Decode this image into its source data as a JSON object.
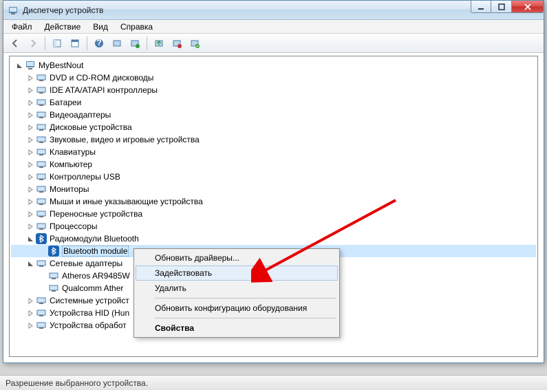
{
  "window": {
    "title": "Диспетчер устройств"
  },
  "menubar": {
    "items": [
      "Файл",
      "Действие",
      "Вид",
      "Справка"
    ]
  },
  "tree": {
    "root": "MyBestNout",
    "categories": [
      {
        "label": "DVD и CD-ROM дисководы",
        "expanded": false
      },
      {
        "label": "IDE ATA/ATAPI контроллеры",
        "expanded": false
      },
      {
        "label": "Батареи",
        "expanded": false
      },
      {
        "label": "Видеоадаптеры",
        "expanded": false
      },
      {
        "label": "Дисковые устройства",
        "expanded": false
      },
      {
        "label": "Звуковые, видео и игровые устройства",
        "expanded": false
      },
      {
        "label": "Клавиатуры",
        "expanded": false
      },
      {
        "label": "Компьютер",
        "expanded": false
      },
      {
        "label": "Контроллеры USB",
        "expanded": false
      },
      {
        "label": "Мониторы",
        "expanded": false
      },
      {
        "label": "Мыши и иные указывающие устройства",
        "expanded": false
      },
      {
        "label": "Переносные устройства",
        "expanded": false
      },
      {
        "label": "Процессоры",
        "expanded": false
      },
      {
        "label": "Радиомодули Bluetooth",
        "expanded": true,
        "children": [
          {
            "label": "Bluetooth module",
            "selected": true
          }
        ]
      },
      {
        "label": "Сетевые адаптеры",
        "expanded": true,
        "children": [
          {
            "label": "Atheros AR9485W"
          },
          {
            "label": "Qualcomm Ather"
          }
        ]
      },
      {
        "label": "Системные устройст",
        "expanded": false
      },
      {
        "label": "Устройства HID (Hun",
        "expanded": false
      },
      {
        "label": "Устройства обработ",
        "expanded": false
      }
    ]
  },
  "context_menu": {
    "items": [
      {
        "label": "Обновить драйверы..."
      },
      {
        "label": "Задействовать",
        "hover": true
      },
      {
        "label": "Удалить"
      },
      {
        "sep": true
      },
      {
        "label": "Обновить конфигурацию оборудования"
      },
      {
        "sep": true
      },
      {
        "label": "Свойства",
        "bold": true
      }
    ]
  },
  "statusbar": {
    "text": "Разрешение выбранного устройства."
  },
  "colors": {
    "accent": "#cde8ff",
    "close": "#d9534f",
    "arrow": "#e60000"
  }
}
